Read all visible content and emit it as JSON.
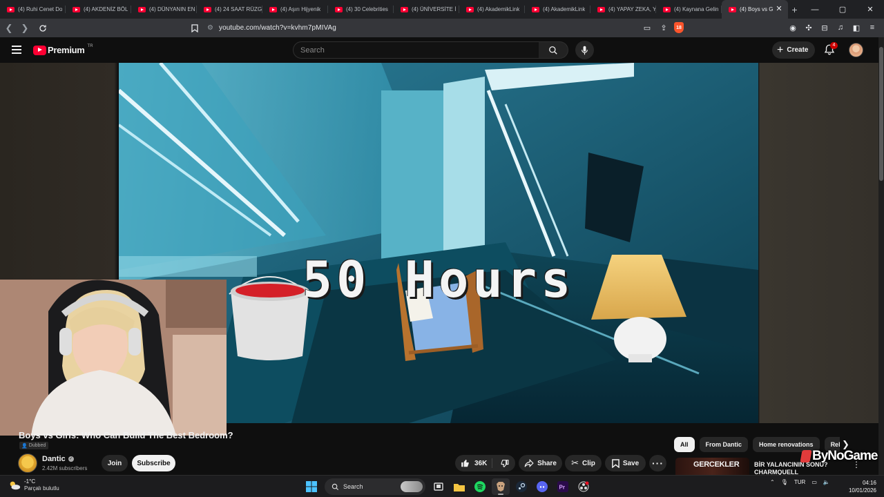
{
  "browser": {
    "tabs": [
      {
        "title": "(4) Ruhi Cenet Do"
      },
      {
        "title": "(4) AKDENİZ BÖL"
      },
      {
        "title": "(4) DÜNYANIN EN"
      },
      {
        "title": "(4) 24 SAAT RÜZG"
      },
      {
        "title": "(4) Aşırı Hijyenik"
      },
      {
        "title": "(4) 30 Celebrities"
      },
      {
        "title": "(4) ÜNİVERSİTE İ"
      },
      {
        "title": "(4) AkademikLink"
      },
      {
        "title": "(4) AkademikLink"
      },
      {
        "title": "(4) YAPAY ZEKA, Y"
      },
      {
        "title": "(4) Kaynana Gelin"
      },
      {
        "title": "(4) Boys vs G"
      }
    ],
    "active_tab_index": 11,
    "new_tab_label": "+",
    "url": "youtube.com/watch?v=kvhm7pMIVAg",
    "shield_count": "18"
  },
  "youtube": {
    "logo_text": "Premium",
    "region": "TR",
    "search_placeholder": "Search",
    "create_label": "Create",
    "notification_count": "4"
  },
  "video": {
    "overlay_text": "50 Hours",
    "title": "Boys vs Girls: Who Can Build The Best Bedroom?",
    "dubbed_label": "Dubbed",
    "channel_name": "Dantic",
    "subscribers": "2.42M subscribers",
    "join_label": "Join",
    "subscribe_label": "Subscribe",
    "like_count": "36K",
    "share_label": "Share",
    "clip_label": "Clip",
    "save_label": "Save"
  },
  "sidebar": {
    "chips": [
      "All",
      "From Dantic",
      "Home renovations",
      "Relat"
    ],
    "recommendation": {
      "thumb_text": "GERCEKLER",
      "title": "BİR YALANCININ SONU? CHARMQUELL"
    },
    "watermark": "ByNoGame"
  },
  "taskbar": {
    "temperature": "-1°C",
    "weather": "Parçalı bulutlu",
    "search_label": "Search",
    "language": "TUR",
    "time": "04:16",
    "date": "10/01/2026"
  },
  "colors": {
    "youtube_red": "#ff0033",
    "background": "#0f0f0f",
    "surface": "#272727",
    "notification_red": "#cc0000"
  }
}
